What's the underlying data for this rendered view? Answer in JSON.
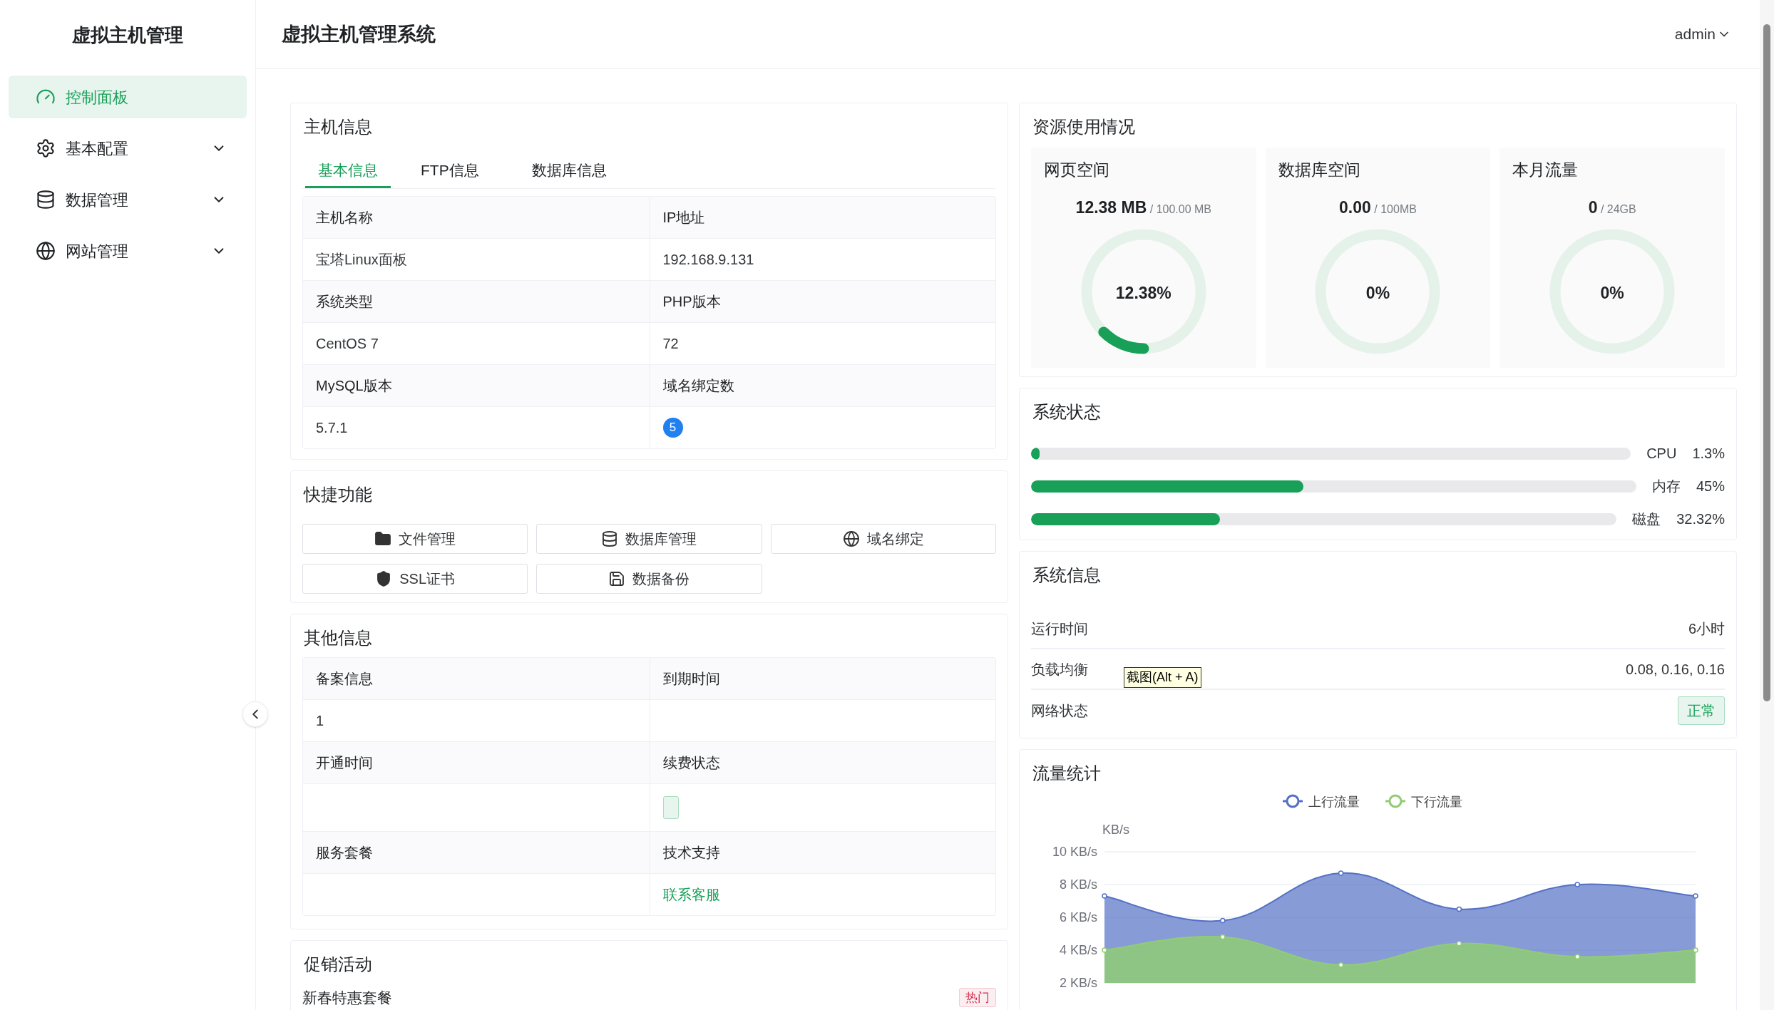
{
  "sidebar": {
    "title": "虚拟主机管理",
    "items": [
      {
        "label": "控制面板",
        "selected": true,
        "expandable": false
      },
      {
        "label": "基本配置",
        "selected": false,
        "expandable": true
      },
      {
        "label": "数据管理",
        "selected": false,
        "expandable": true
      },
      {
        "label": "网站管理",
        "selected": false,
        "expandable": true
      }
    ]
  },
  "header": {
    "title": "虚拟主机管理系统",
    "user": "admin"
  },
  "host_info": {
    "title": "主机信息",
    "tabs": [
      {
        "label": "基本信息",
        "selected": true
      },
      {
        "label": "FTP信息",
        "selected": false
      },
      {
        "label": "数据库信息",
        "selected": false
      }
    ],
    "rows": [
      {
        "kind": "label",
        "cells": [
          {
            "kind": "text",
            "text": "主机名称"
          },
          {
            "kind": "text",
            "text": "IP地址"
          }
        ]
      },
      {
        "kind": "value",
        "cells": [
          {
            "kind": "text",
            "text": "宝塔Linux面板"
          },
          {
            "kind": "text",
            "text": "192.168.9.131"
          }
        ]
      },
      {
        "kind": "label",
        "cells": [
          {
            "kind": "text",
            "text": "系统类型"
          },
          {
            "kind": "text",
            "text": "PHP版本"
          }
        ]
      },
      {
        "kind": "value",
        "cells": [
          {
            "kind": "text",
            "text": "CentOS 7"
          },
          {
            "kind": "text",
            "text": "72"
          }
        ]
      },
      {
        "kind": "label",
        "cells": [
          {
            "kind": "text",
            "text": "MySQL版本"
          },
          {
            "kind": "text",
            "text": "域名绑定数"
          }
        ]
      },
      {
        "kind": "value",
        "cells": [
          {
            "kind": "text",
            "text": "5.7.1"
          },
          {
            "kind": "badge",
            "text": "5"
          }
        ]
      }
    ]
  },
  "quick_actions": {
    "title": "快捷功能",
    "buttons": [
      {
        "label": "文件管理"
      },
      {
        "label": "数据库管理"
      },
      {
        "label": "域名绑定"
      },
      {
        "label": "SSL证书"
      },
      {
        "label": "数据备份"
      }
    ]
  },
  "other_info": {
    "title": "其他信息",
    "rows": [
      {
        "kind": "label",
        "cells": [
          {
            "kind": "text",
            "text": "备案信息"
          },
          {
            "kind": "text",
            "text": "到期时间"
          }
        ]
      },
      {
        "kind": "value",
        "cells": [
          {
            "kind": "text",
            "text": "1"
          },
          {
            "kind": "empty"
          }
        ]
      },
      {
        "kind": "label",
        "cells": [
          {
            "kind": "text",
            "text": "开通时间"
          },
          {
            "kind": "text",
            "text": "续费状态"
          }
        ]
      },
      {
        "kind": "value",
        "cells": [
          {
            "kind": "empty"
          },
          {
            "kind": "tag"
          }
        ]
      },
      {
        "kind": "label",
        "cells": [
          {
            "kind": "text",
            "text": "服务套餐"
          },
          {
            "kind": "text",
            "text": "技术支持"
          }
        ]
      },
      {
        "kind": "value",
        "cells": [
          {
            "kind": "empty"
          },
          {
            "kind": "link",
            "text": "联系客服"
          }
        ]
      }
    ]
  },
  "promotions": {
    "title": "促销活动",
    "items": [
      {
        "name": "新春特惠套餐",
        "badge": "热门"
      }
    ]
  },
  "resources": {
    "title": "资源使用情况",
    "gauges": [
      {
        "label": "网页空间",
        "used": "12.38 MB",
        "total": "/ 100.00 MB",
        "percent": "12.38%",
        "level": 0.1238
      },
      {
        "label": "数据库空间",
        "used": "0.00",
        "total": "/ 100MB",
        "percent": "0%",
        "level": 0
      },
      {
        "label": "本月流量",
        "used": "0",
        "total": "/ 24GB",
        "percent": "0%",
        "level": 0
      }
    ]
  },
  "system_status": {
    "title": "系统状态",
    "meters": [
      {
        "label": "CPU",
        "reading": "1.3%",
        "level": 0.013
      },
      {
        "label": "内存",
        "reading": "45%",
        "level": 0.45
      },
      {
        "label": "磁盘",
        "reading": "32.32%",
        "level": 0.3232
      }
    ]
  },
  "system_info": {
    "title": "系统信息",
    "rows": [
      {
        "kind": "text",
        "label": "运行时间",
        "value": "6小时"
      },
      {
        "kind": "text",
        "label": "负载均衡",
        "value": "0.08, 0.16, 0.16"
      },
      {
        "kind": "tag",
        "label": "网络状态",
        "value": "正常"
      }
    ],
    "tooltip": "截图(Alt + A)"
  },
  "traffic": {
    "title": "流量统计",
    "chart_data": {
      "type": "area",
      "ylabel": "KB/s",
      "legend": "top",
      "ylim": [
        2,
        10
      ],
      "yticks": [
        {
          "value": 2,
          "label": "2 KB/s"
        },
        {
          "value": 4,
          "label": "4 KB/s"
        },
        {
          "value": 6,
          "label": "6 KB/s"
        },
        {
          "value": 8,
          "label": "8 KB/s"
        },
        {
          "value": 10,
          "label": "10 KB/s"
        }
      ],
      "series": [
        {
          "name": "上行流量",
          "color": "#5470c6",
          "values": [
            7.3,
            5.8,
            8.7,
            6.5,
            8.0,
            7.3
          ]
        },
        {
          "name": "下行流量",
          "color": "#91cc75",
          "values": [
            4.0,
            4.8,
            3.1,
            4.4,
            3.6,
            4.0
          ]
        }
      ]
    }
  }
}
